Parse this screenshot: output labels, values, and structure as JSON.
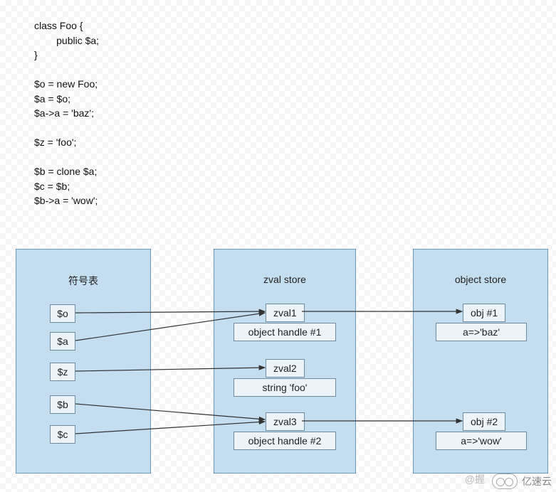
{
  "code": {
    "lines": [
      "class Foo {",
      "        public $a;",
      "}",
      "",
      "$o = new Foo;",
      "$a = $o;",
      "$a->a = 'baz';",
      "",
      "$z = 'foo';",
      "",
      "$b = clone $a;",
      "$c = $b;",
      "$b->a = 'wow';"
    ]
  },
  "panels": {
    "symbol": {
      "title": "符号表"
    },
    "zval": {
      "title": "zval store"
    },
    "object": {
      "title": "object store"
    }
  },
  "symbol_vars": {
    "o": "$o",
    "a": "$a",
    "z": "$z",
    "b": "$b",
    "c": "$c"
  },
  "zvals": {
    "z1_name": "zval1",
    "z1_body": "object handle #1",
    "z2_name": "zval2",
    "z2_body": "string 'foo'",
    "z3_name": "zval3",
    "z3_body": "object handle #2"
  },
  "objects": {
    "o1_name": "obj #1",
    "o1_body": "a=>'baz'",
    "o2_name": "obj #2",
    "o2_body": "a=>'wow'"
  },
  "watermark": {
    "at": "@握",
    "brand": "亿速云"
  }
}
